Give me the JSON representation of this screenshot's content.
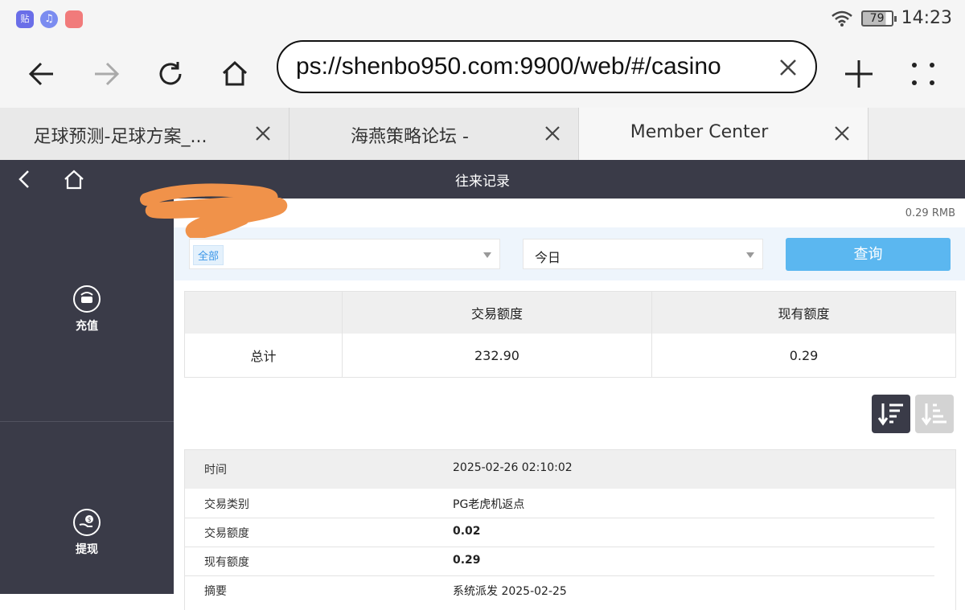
{
  "status_bar": {
    "battery": "79",
    "time": "14:23",
    "app_icon_colors": [
      "#6a6ee8",
      "#7b8cf0",
      "#f17b7b"
    ]
  },
  "browser": {
    "url": "ps://shenbo950.com:9900/web/#/casino",
    "tabs": [
      {
        "title": "足球预测-足球方案_..."
      },
      {
        "title": "海燕策略论坛 -"
      },
      {
        "title": "Member Center"
      }
    ]
  },
  "app_header": {
    "title": "往来记录"
  },
  "sidebar": {
    "items": [
      {
        "label": "充值",
        "icon": "recharge-icon"
      },
      {
        "label": "提现",
        "icon": "withdraw-icon"
      }
    ]
  },
  "balance": {
    "text": "0.29 RMB"
  },
  "filters": {
    "type_value": "全部",
    "date_value": "今日",
    "query_label": "查询"
  },
  "summary": {
    "headers": [
      "",
      "交易额度",
      "现有额度"
    ],
    "row": {
      "label": "总计",
      "transaction_amount": "232.90",
      "current_amount": "0.29"
    }
  },
  "record": {
    "time_label": "时间",
    "time_value": "2025-02-26 02:10:02",
    "rows": [
      {
        "label": "交易类别",
        "value": "PG老虎机返点"
      },
      {
        "label": "交易额度",
        "value": "0.02"
      },
      {
        "label": "现有额度",
        "value": "0.29"
      },
      {
        "label": "摘要",
        "value": "系统派发 2025-02-25"
      }
    ]
  },
  "colors": {
    "dark": "#3a3b48",
    "accent": "#5bb7f0",
    "redaction": "#f0924a"
  }
}
